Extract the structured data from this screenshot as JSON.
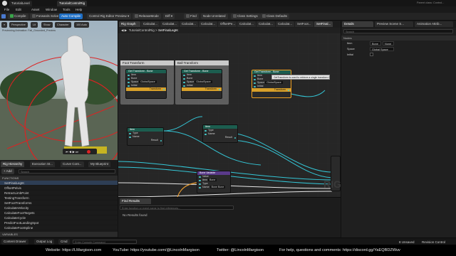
{
  "window": {
    "project_tab": "TutorialLevel",
    "asset_tab": "TutorialControlRig",
    "parent_class": "Parent class:",
    "parent_value": "Control..."
  },
  "menu": [
    "File",
    "Edit",
    "Asset",
    "Window",
    "Tools",
    "Help"
  ],
  "toolbar": {
    "compile": "Compile",
    "forwards_solve": "Forwards Solve",
    "auto_compile": "Auto Compile",
    "preview": "Control Rig Editor Preview",
    "release_mode": "ReleaseMode",
    "diff": "Diff",
    "find": "Find",
    "nodes_unrelated": "Node Unrelated",
    "class_settings": "Class Settings",
    "class_defaults": "Class Defaults"
  },
  "viewport": {
    "perspective": "Perspective",
    "lit": "Lit",
    "show": "Show",
    "character": "Character",
    "fps": "100 Auto",
    "status": "Previewing Animation: Fall_Grounded_Preview"
  },
  "graph_tabs": [
    "Rig Graph",
    "Calculat...",
    "Calculat...",
    "Calculat...",
    "Calculat...",
    "OffsetPe...",
    "Calculat...",
    "Calculat...",
    "Calculat...",
    "SetFoot...",
    "SetFinal..."
  ],
  "breadcrumb": {
    "rig": "TutorialControlRig",
    "fn": "SetFinalLegIK"
  },
  "comments": [
    {
      "title": "Foot Transform"
    },
    {
      "title": "Ball Transform"
    }
  ],
  "nodes": {
    "get_a": {
      "title": "Get Transform - Bone",
      "pins": [
        "Item",
        "Bone",
        "Space",
        "Initial"
      ],
      "space_val": "GlobalSpace",
      "out": "Transform"
    },
    "get_b": {
      "title": "Get Transform - Bone",
      "pins": [
        "Item",
        "Bone",
        "Space",
        "Initial"
      ],
      "space_val": "GlobalSpace",
      "out": "Transform"
    },
    "get_c": {
      "title": "Get Transform - Bone",
      "pins": [
        "Item",
        "Bone",
        "Space",
        "Initial"
      ],
      "space_val": "GlobalSpace",
      "out": "Transform"
    },
    "tooltip": "GetTransform is used to retrieve a single transform from a hierarchy.",
    "item_a": {
      "title": "Item",
      "pins": [
        "Type",
        "Name"
      ],
      "out": "Result"
    },
    "item_b": {
      "title": "Item",
      "pins": [
        "Type",
        "Name"
      ],
      "out": "Result"
    },
    "bone_get": {
      "title": "Bone Variable",
      "pins": [
        "Value",
        "Item",
        "Type",
        "Name"
      ],
      "vals": [
        "",
        "Bone",
        "",
        "Bone Bone"
      ]
    },
    "watermark": "RIG"
  },
  "rig_panel": {
    "tabs": [
      "Rig Hierarchy",
      "Execution St...",
      "Curve Cont...",
      "My Blueprint"
    ],
    "add": "+ Add",
    "search": "Search",
    "section": "FUNCTIONS",
    "functions": [
      "SetFinalLegIK",
      "OffsetPelvis",
      "RetractLimbPoint",
      "TestingTransform",
      "SetFootTransforms",
      "CalculateVelocity",
      "CalculateFootTargets",
      "CalculateCycle",
      "PredictFootLandingSpot",
      "CalculateFootSpline"
    ],
    "variables": "VARIABLES"
  },
  "find": {
    "title": "Find Results",
    "placeholder": "Enter function or event name to find references...",
    "result": "No Results found"
  },
  "details_panel": {
    "tabs": [
      "Details",
      "Preview Scene S...",
      "Animation Attrib..."
    ],
    "search": "Search",
    "section": "Nodes",
    "props": [
      {
        "label": "Item",
        "value": "Bone"
      },
      {
        "label": "Space",
        "value": "Global Space"
      },
      {
        "label": "Initial",
        "value": ""
      }
    ],
    "item_val2": "None"
  },
  "status": {
    "content_drawer": "Content Drawer",
    "output_log": "Output Log",
    "cmd": "Cmd",
    "console_placeholder": "Enter Console Command",
    "unsaved": "8 Unsaved",
    "revision": "Revision Control"
  },
  "footer": {
    "website": "Website: https://LMargison.com",
    "youtube": "YouTube: https://youtube.com/@LincolnMargison",
    "twitter": "Twitter: @LincolnMargison",
    "help": "For help, questions and comments: https://discord.gg/YaEQBDZWuv"
  },
  "colors": {
    "accent": "#1f6fc5",
    "selected": "#f0a020",
    "wire": "#34c6d6",
    "wire_exec": "#e6e6e6",
    "wire_orange": "#f0a030"
  }
}
